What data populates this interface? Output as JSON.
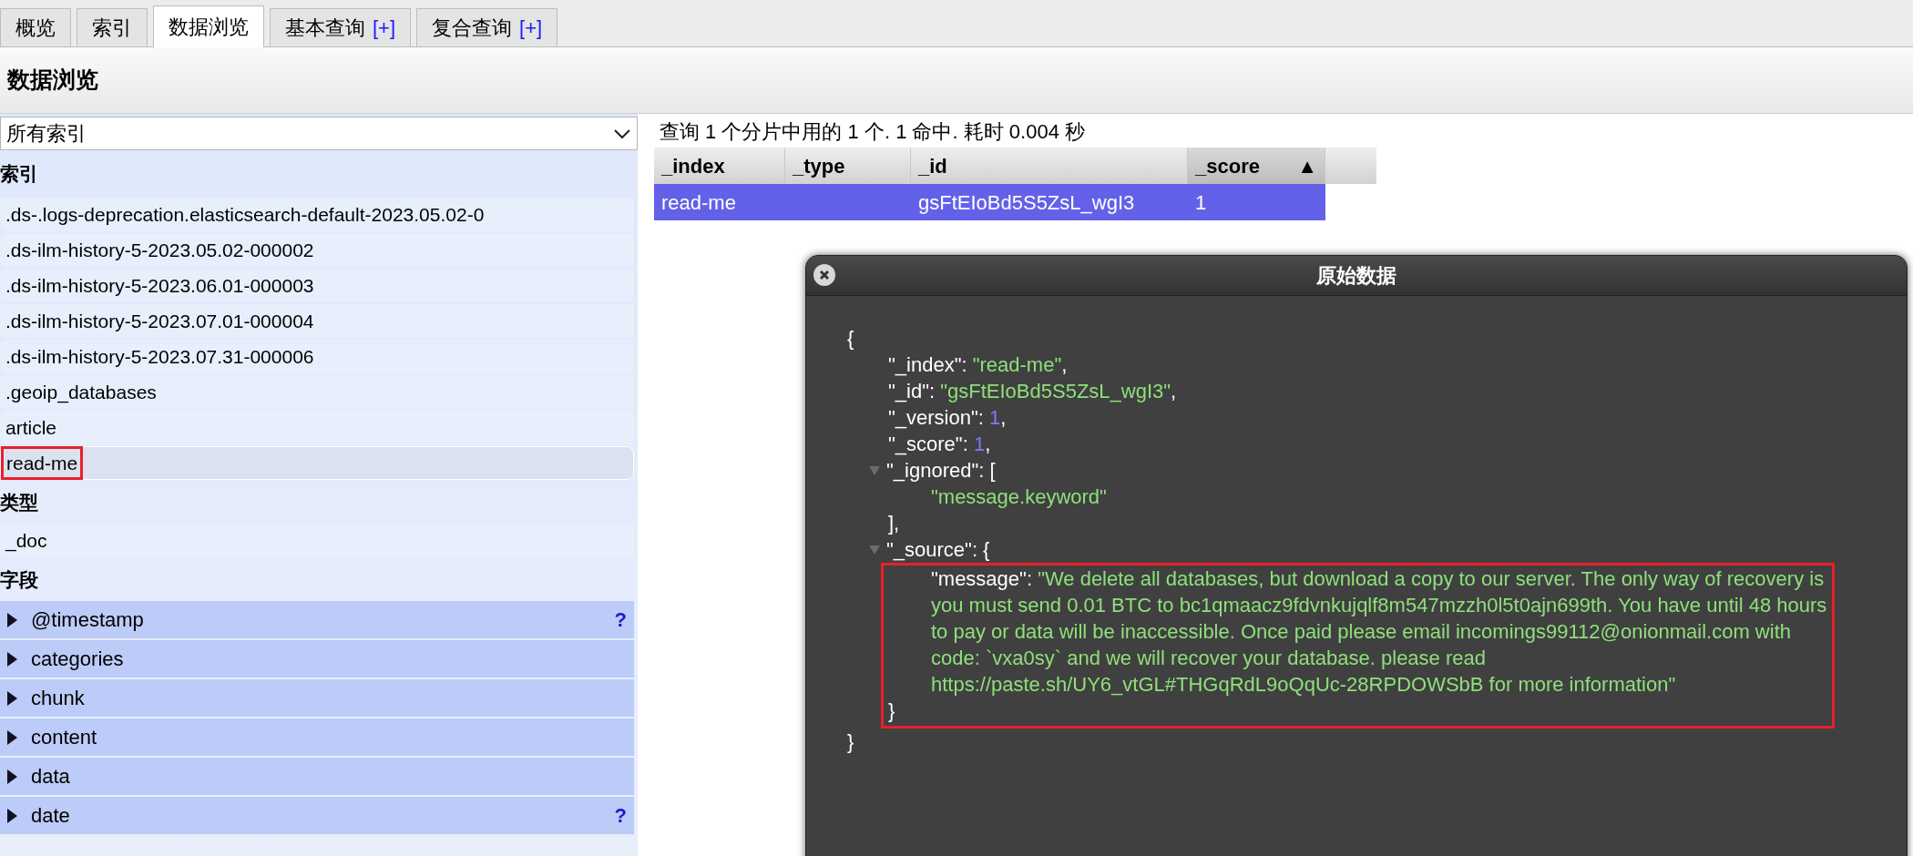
{
  "tabs": [
    {
      "label": "概览",
      "selected": false
    },
    {
      "label": "索引",
      "selected": false
    },
    {
      "label": "数据浏览",
      "selected": true
    },
    {
      "label": "基本查询",
      "extra": "[+]",
      "selected": false
    },
    {
      "label": "复合查询",
      "extra": "[+]",
      "selected": false
    }
  ],
  "page_title": "数据浏览",
  "sidebar": {
    "index_select": {
      "value": "所有索引"
    },
    "sections": [
      {
        "heading": "索引",
        "kind": "plain",
        "items": [
          {
            "label": ".ds-.logs-deprecation.elasticsearch-default-2023.05.02-0",
            "selected": false,
            "flagged": false
          },
          {
            "label": ".ds-ilm-history-5-2023.05.02-000002",
            "selected": false,
            "flagged": false
          },
          {
            "label": ".ds-ilm-history-5-2023.06.01-000003",
            "selected": false,
            "flagged": false
          },
          {
            "label": ".ds-ilm-history-5-2023.07.01-000004",
            "selected": false,
            "flagged": false
          },
          {
            "label": ".ds-ilm-history-5-2023.07.31-000006",
            "selected": false,
            "flagged": false
          },
          {
            "label": ".geoip_databases",
            "selected": false,
            "flagged": false
          },
          {
            "label": "article",
            "selected": false,
            "flagged": false
          },
          {
            "label": "read-me",
            "selected": true,
            "flagged": true
          }
        ]
      },
      {
        "heading": "类型",
        "kind": "plain",
        "items": [
          {
            "label": "_doc",
            "selected": false,
            "flagged": false
          }
        ]
      },
      {
        "heading": "字段",
        "kind": "field",
        "items": [
          {
            "label": "@timestamp",
            "hint": "?",
            "expanded": false
          },
          {
            "label": "categories",
            "expanded": false
          },
          {
            "label": "chunk",
            "expanded": false
          },
          {
            "label": "content",
            "expanded": false
          },
          {
            "label": "data",
            "expanded": false
          },
          {
            "label": "date",
            "hint": "?",
            "expanded": false
          }
        ]
      }
    ]
  },
  "results": {
    "summary": "查询 1 个分片中用的 1 个. 1 命中. 耗时 0.004 秒",
    "columns": [
      {
        "label": "_index"
      },
      {
        "label": "_type"
      },
      {
        "label": "_id"
      },
      {
        "label": "_score",
        "sort_mark": "▲"
      }
    ],
    "rows": [
      {
        "index": "read-me",
        "id": "gsFtEIoBd5S5ZsL_wgI3",
        "score": "1",
        "selected": true
      }
    ]
  },
  "raw_data": {
    "title": "原始数据",
    "open": "{",
    "close": "}",
    "children": [
      {
        "kind": "string",
        "key": "\"_index\"",
        "sep": ": ",
        "value": "\"read-me\"",
        "trail": ","
      },
      {
        "kind": "string",
        "key": "\"_id\"",
        "sep": ": ",
        "value": "\"gsFtEIoBd5S5ZsL_wgI3\"",
        "trail": ","
      },
      {
        "kind": "number",
        "key": "\"_version\"",
        "sep": ": ",
        "value": "1",
        "trail": ","
      },
      {
        "kind": "number",
        "key": "\"_score\"",
        "sep": ": ",
        "value": "1",
        "trail": ","
      },
      {
        "kind": "group",
        "key": "\"_ignored\"",
        "sep": ": ",
        "open": "[",
        "expanded": true,
        "flagged": false,
        "close": "],",
        "children": [
          {
            "kind": "string",
            "value": "\"message.keyword\""
          }
        ]
      },
      {
        "kind": "group",
        "key": "\"_source\"",
        "sep": ": ",
        "open": "{",
        "expanded": true,
        "flagged": true,
        "close": "}",
        "children": [
          {
            "kind": "string",
            "key": "\"message\"",
            "sep": ": ",
            "value": "\"We delete all databases, but download a copy to our server. The only way of recovery is you must send 0.01 BTC to bc1qmaacz9fdvnkujqlf8m547mzzh0l5t0ajn699th. You have until 48 hours to pay or data will be inaccessible. Once paid please email incomings99112@onionmail.com with code: `vxa0sy` and we will recover your database. please read https://paste.sh/UY6_vtGL#THGqRdL9oQqUc-28RPDOWSbB for more information\""
          }
        ]
      }
    ]
  }
}
